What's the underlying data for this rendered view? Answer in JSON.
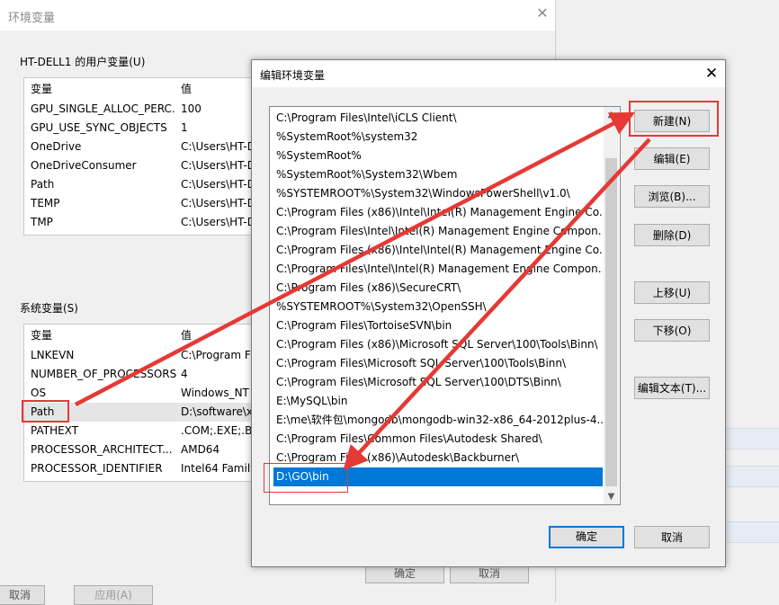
{
  "bg_window": {
    "title": "环境变量",
    "user_group_label": "HT-DELL1 的用户变量(U)",
    "user_vars": {
      "col_name": "变量",
      "col_value": "值",
      "rows": [
        {
          "name": "GPU_SINGLE_ALLOC_PERC...",
          "value": "100"
        },
        {
          "name": "GPU_USE_SYNC_OBJECTS",
          "value": "1"
        },
        {
          "name": "OneDrive",
          "value": "C:\\Users\\HT-D"
        },
        {
          "name": "OneDriveConsumer",
          "value": "C:\\Users\\HT-D"
        },
        {
          "name": "Path",
          "value": "C:\\Users\\HT-D"
        },
        {
          "name": "TEMP",
          "value": "C:\\Users\\HT-D"
        },
        {
          "name": "TMP",
          "value": "C:\\Users\\HT-D"
        }
      ]
    },
    "system_group_label": "系统变量(S)",
    "system_vars": {
      "col_name": "变量",
      "col_value": "值",
      "rows": [
        {
          "name": "LNKEVN",
          "value": "C:\\Program F"
        },
        {
          "name": "NUMBER_OF_PROCESSORS",
          "value": "4"
        },
        {
          "name": "OS",
          "value": "Windows_NT"
        },
        {
          "name": "Path",
          "value": "D:\\software\\x"
        },
        {
          "name": "PATHEXT",
          "value": ".COM;.EXE;.BA"
        },
        {
          "name": "PROCESSOR_ARCHITECT...",
          "value": "AMD64"
        },
        {
          "name": "PROCESSOR_IDENTIFIER",
          "value": "Intel64 Family"
        }
      ]
    },
    "ok_label": "确定",
    "cancel_label": "取消",
    "footer_left": "取消",
    "footer_apply": "应用(A)"
  },
  "dialog": {
    "title": "编辑环境变量",
    "paths": [
      "C:\\Program Files\\Intel\\iCLS Client\\",
      "%SystemRoot%\\system32",
      "%SystemRoot%",
      "%SystemRoot%\\System32\\Wbem",
      "%SYSTEMROOT%\\System32\\WindowsPowerShell\\v1.0\\",
      "C:\\Program Files (x86)\\Intel\\Intel(R) Management Engine Co...",
      "C:\\Program Files\\Intel\\Intel(R) Management Engine Compon...",
      "C:\\Program Files (x86)\\Intel\\Intel(R) Management Engine Co...",
      "C:\\Program Files\\Intel\\Intel(R) Management Engine Compon...",
      "C:\\Program Files (x86)\\SecureCRT\\",
      "%SYSTEMROOT%\\System32\\OpenSSH\\",
      "C:\\Program Files\\TortoiseSVN\\bin",
      "C:\\Program Files (x86)\\Microsoft SQL Server\\100\\Tools\\Binn\\",
      "C:\\Program Files\\Microsoft SQL Server\\100\\Tools\\Binn\\",
      "C:\\Program Files\\Microsoft SQL Server\\100\\DTS\\Binn\\",
      "E:\\MySQL\\bin",
      "E:\\me\\软件包\\mongodb\\mongodb-win32-x86_64-2012plus-4....",
      "C:\\Program Files\\Common Files\\Autodesk Shared\\",
      "C:\\Program Files (x86)\\Autodesk\\Backburner\\",
      "D:\\GO\\bin"
    ],
    "selected_index": 19,
    "buttons": {
      "new": "新建(N)",
      "edit": "编辑(E)",
      "browse": "浏览(B)...",
      "delete": "删除(D)",
      "move_up": "上移(U)",
      "move_down": "下移(O)",
      "edit_text": "编辑文本(T)...",
      "ok": "确定",
      "cancel": "取消"
    }
  },
  "annotation_color": "#e53935",
  "selection_color": "#0078d7"
}
